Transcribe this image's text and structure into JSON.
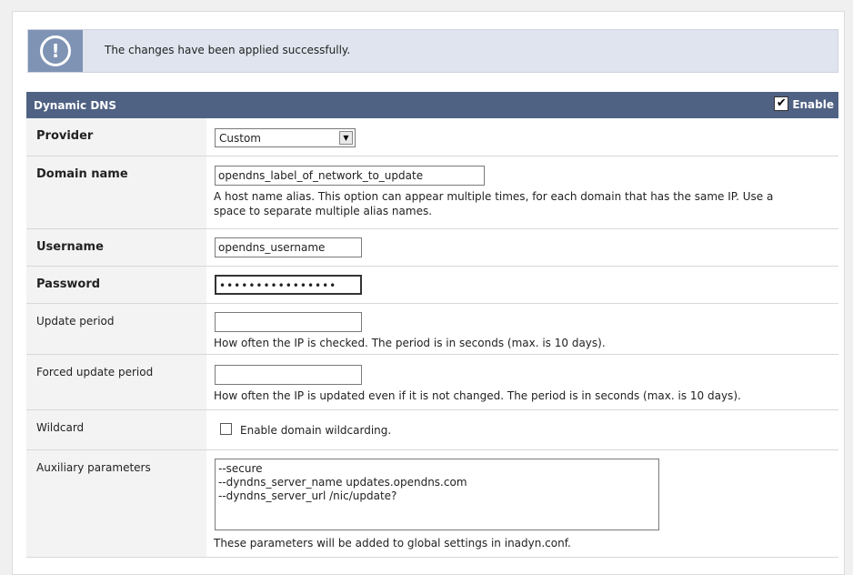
{
  "notice": {
    "icon": "exclamation-icon",
    "text": "The changes have been applied successfully."
  },
  "section": {
    "title": "Dynamic DNS",
    "enable_label": "Enable",
    "enable_checked_glyph": "✔",
    "enable_checked": true
  },
  "fields": {
    "provider": {
      "label": "Provider",
      "value": "Custom"
    },
    "domain": {
      "label": "Domain name",
      "value": "opendns_label_of_network_to_update",
      "help_line1": "A host name alias. This option can appear multiple times, for each domain that has the same IP. Use a",
      "help_line2": "space to separate multiple alias names."
    },
    "username": {
      "label": "Username",
      "value": "opendns_username"
    },
    "password": {
      "label": "Password",
      "value": "••••••••••••••••"
    },
    "update_period": {
      "label": "Update period",
      "value": "",
      "help": "How often the IP is checked. The period is in seconds (max. is 10 days)."
    },
    "forced_update_period": {
      "label": "Forced update period",
      "value": "",
      "help": "How often the IP is updated even if it is not changed. The period is in seconds (max. is 10 days)."
    },
    "wildcard": {
      "label": "Wildcard",
      "checkbox_label": "Enable domain wildcarding.",
      "checked": false
    },
    "aux": {
      "label": "Auxiliary parameters",
      "lines": [
        "--secure",
        "--dyndns_server_name updates.opendns.com",
        "--dyndns_server_url /nic/update?"
      ],
      "help": "These parameters will be added to global settings in inadyn.conf."
    }
  },
  "colors": {
    "header_bg": "#4f6283",
    "notice_bg": "#dfe4ee",
    "notice_icon_bg": "#7f93b4",
    "label_bg": "#f3f3f3"
  }
}
